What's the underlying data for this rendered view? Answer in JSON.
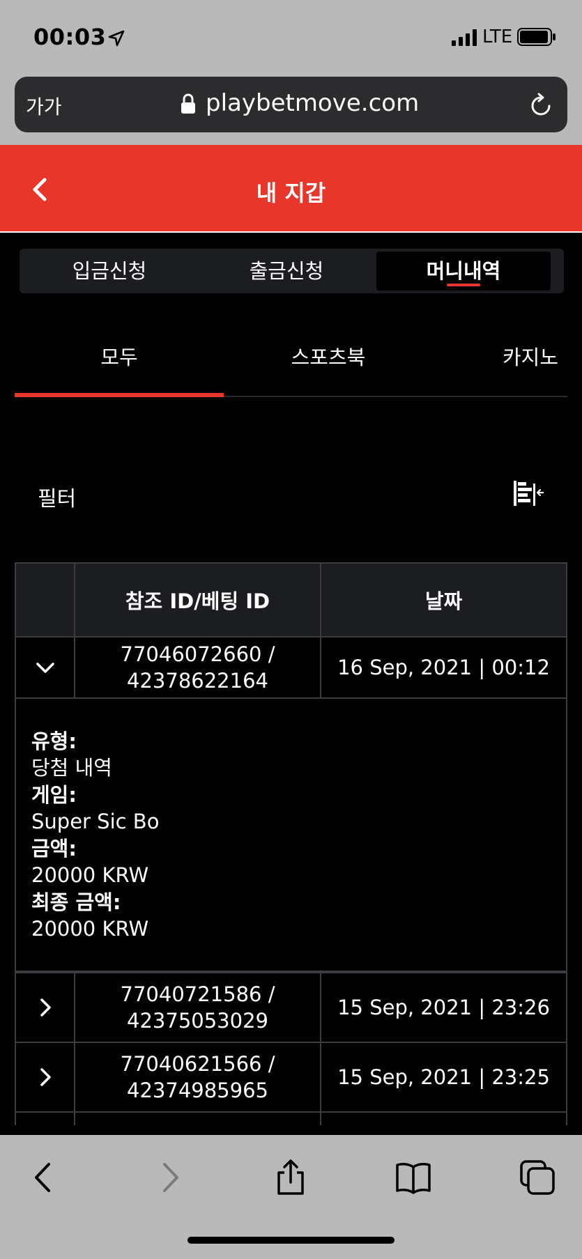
{
  "status_bar": {
    "time": "00:03",
    "network": "LTE"
  },
  "browser": {
    "aa_label": "가가",
    "url": "playbetmove.com"
  },
  "header": {
    "title": "내 지갑"
  },
  "top_tabs": [
    {
      "label": "입금신청"
    },
    {
      "label": "출금신청"
    },
    {
      "label": "머니내역"
    }
  ],
  "sub_tabs": [
    {
      "label": "모두"
    },
    {
      "label": "스포츠북"
    },
    {
      "label": "카지노"
    }
  ],
  "filter": {
    "label": "필터"
  },
  "table": {
    "headers": [
      "참조 ID/베팅 ID",
      "날짜"
    ],
    "rows": [
      {
        "ref_line1": "77046072660 /",
        "ref_line2": "42378622164",
        "date": "16 Sep, 2021 | 00:12",
        "expanded": true
      },
      {
        "ref_line1": "77040721586 /",
        "ref_line2": "42375053029",
        "date": "15 Sep, 2021 | 23:26",
        "expanded": false
      },
      {
        "ref_line1": "77040621566 /",
        "ref_line2": "42374985965",
        "date": "15 Sep, 2021 | 23:25",
        "expanded": false
      }
    ],
    "detail": {
      "type_label": "유형:",
      "type_value": "당첨 내역",
      "game_label": "게임:",
      "game_value": "Super Sic Bo",
      "amount_label": "금액:",
      "amount_value": "20000 KRW",
      "final_label": "최종 금액:",
      "final_value": "20000 KRW"
    }
  },
  "colors": {
    "accent": "#e8372a",
    "background": "#000000",
    "panel": "#1c1d21"
  }
}
